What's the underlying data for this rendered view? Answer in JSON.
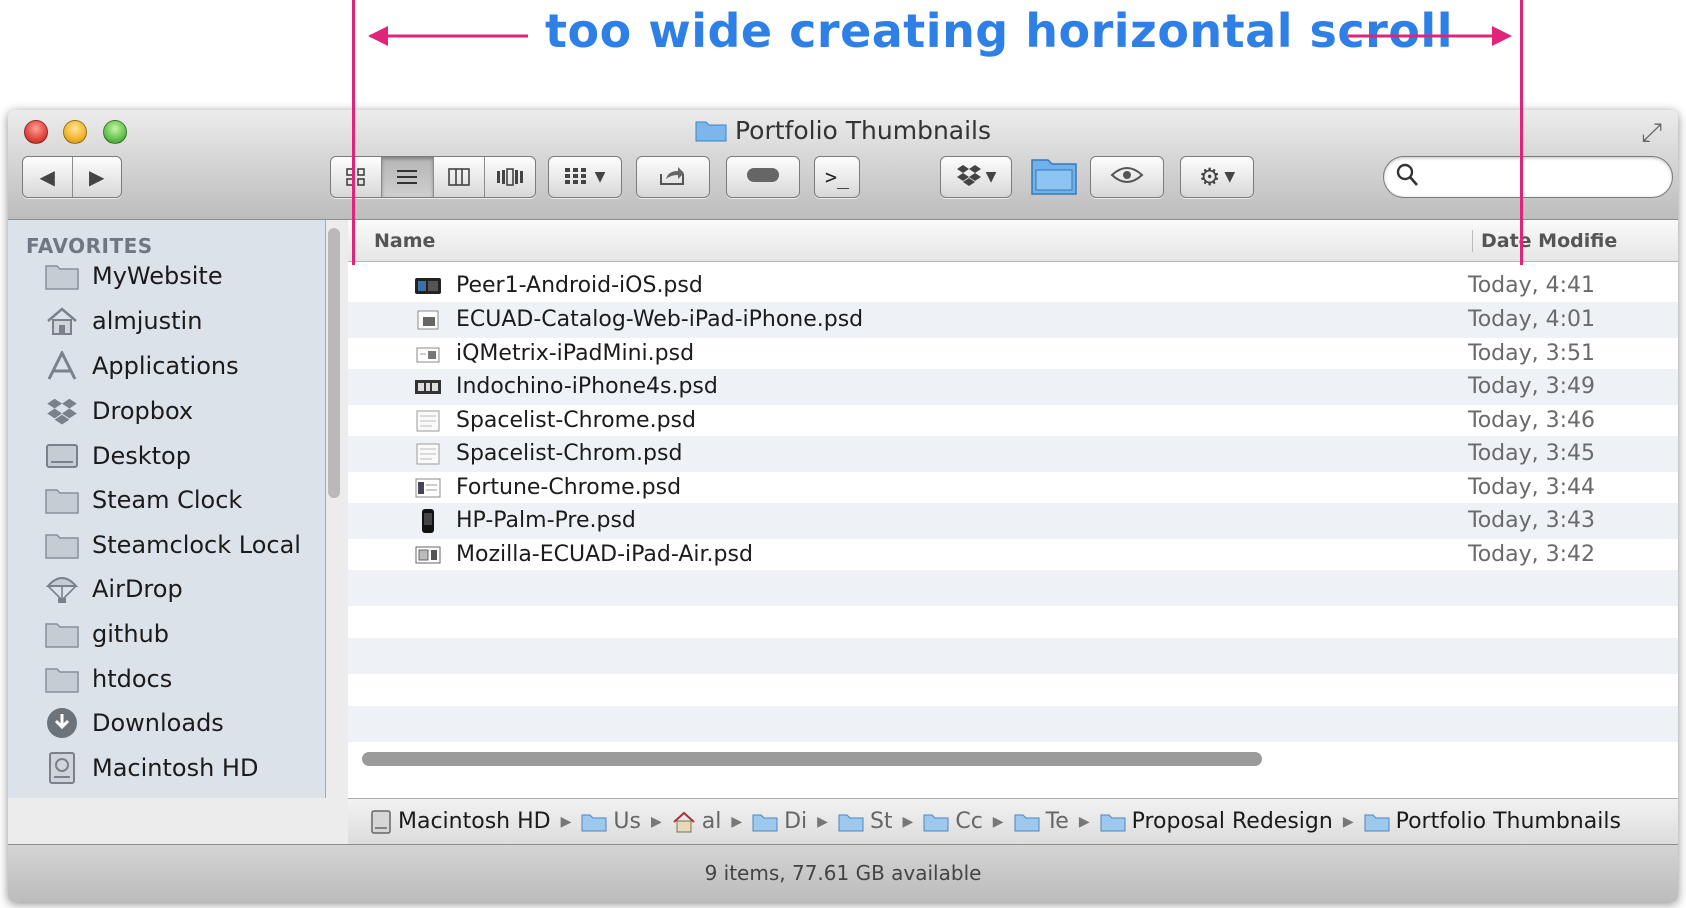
{
  "annotation": {
    "text": "too wide creating horizontal scroll",
    "color": "#e0247a",
    "text_color": "#2f80e6"
  },
  "window": {
    "title": "Portfolio Thumbnails"
  },
  "toolbar": {
    "back_icon": "back-arrow-icon",
    "forward_icon": "forward-arrow-icon",
    "view_modes": [
      "icon-view",
      "list-view",
      "column-view",
      "cover-flow-view"
    ],
    "active_view": "list-view",
    "search_placeholder": ""
  },
  "sidebar": {
    "heading": "FAVORITES",
    "items": [
      {
        "label": "MyWebsite",
        "icon": "folder-icon"
      },
      {
        "label": "almjustin",
        "icon": "home-icon"
      },
      {
        "label": "Applications",
        "icon": "applications-icon"
      },
      {
        "label": "Dropbox",
        "icon": "dropbox-icon"
      },
      {
        "label": "Desktop",
        "icon": "desktop-icon"
      },
      {
        "label": "Steam Clock",
        "icon": "folder-icon"
      },
      {
        "label": "Steamclock Local",
        "icon": "folder-icon"
      },
      {
        "label": "AirDrop",
        "icon": "airdrop-icon"
      },
      {
        "label": "github",
        "icon": "folder-icon"
      },
      {
        "label": "htdocs",
        "icon": "folder-icon"
      },
      {
        "label": "Downloads",
        "icon": "downloads-icon"
      },
      {
        "label": "Macintosh HD",
        "icon": "hard-drive-icon"
      }
    ]
  },
  "list": {
    "columns": [
      "Name",
      "Date Modifie"
    ],
    "files": [
      {
        "name": "Peer1-Android-iOS.psd",
        "date": "Today, 4:41"
      },
      {
        "name": "ECUAD-Catalog-Web-iPad-iPhone.psd",
        "date": "Today, 4:01"
      },
      {
        "name": "iQMetrix-iPadMini.psd",
        "date": "Today, 3:51"
      },
      {
        "name": "Indochino-iPhone4s.psd",
        "date": "Today, 3:49"
      },
      {
        "name": "Spacelist-Chrome.psd",
        "date": "Today, 3:46"
      },
      {
        "name": "Spacelist-Chrom.psd",
        "date": "Today, 3:45"
      },
      {
        "name": "Fortune-Chrome.psd",
        "date": "Today, 3:44"
      },
      {
        "name": "HP-Palm-Pre.psd",
        "date": "Today, 3:43"
      },
      {
        "name": "Mozilla-ECUAD-iPad-Air.psd",
        "date": "Today, 3:42"
      }
    ]
  },
  "pathbar": {
    "crumbs": [
      "Macintosh HD",
      "Us",
      "al",
      "Di",
      "St",
      "Cc",
      "Te",
      "Proposal Redesign",
      "Portfolio Thumbnails"
    ]
  },
  "status": {
    "text": "9 items, 77.61 GB available"
  }
}
